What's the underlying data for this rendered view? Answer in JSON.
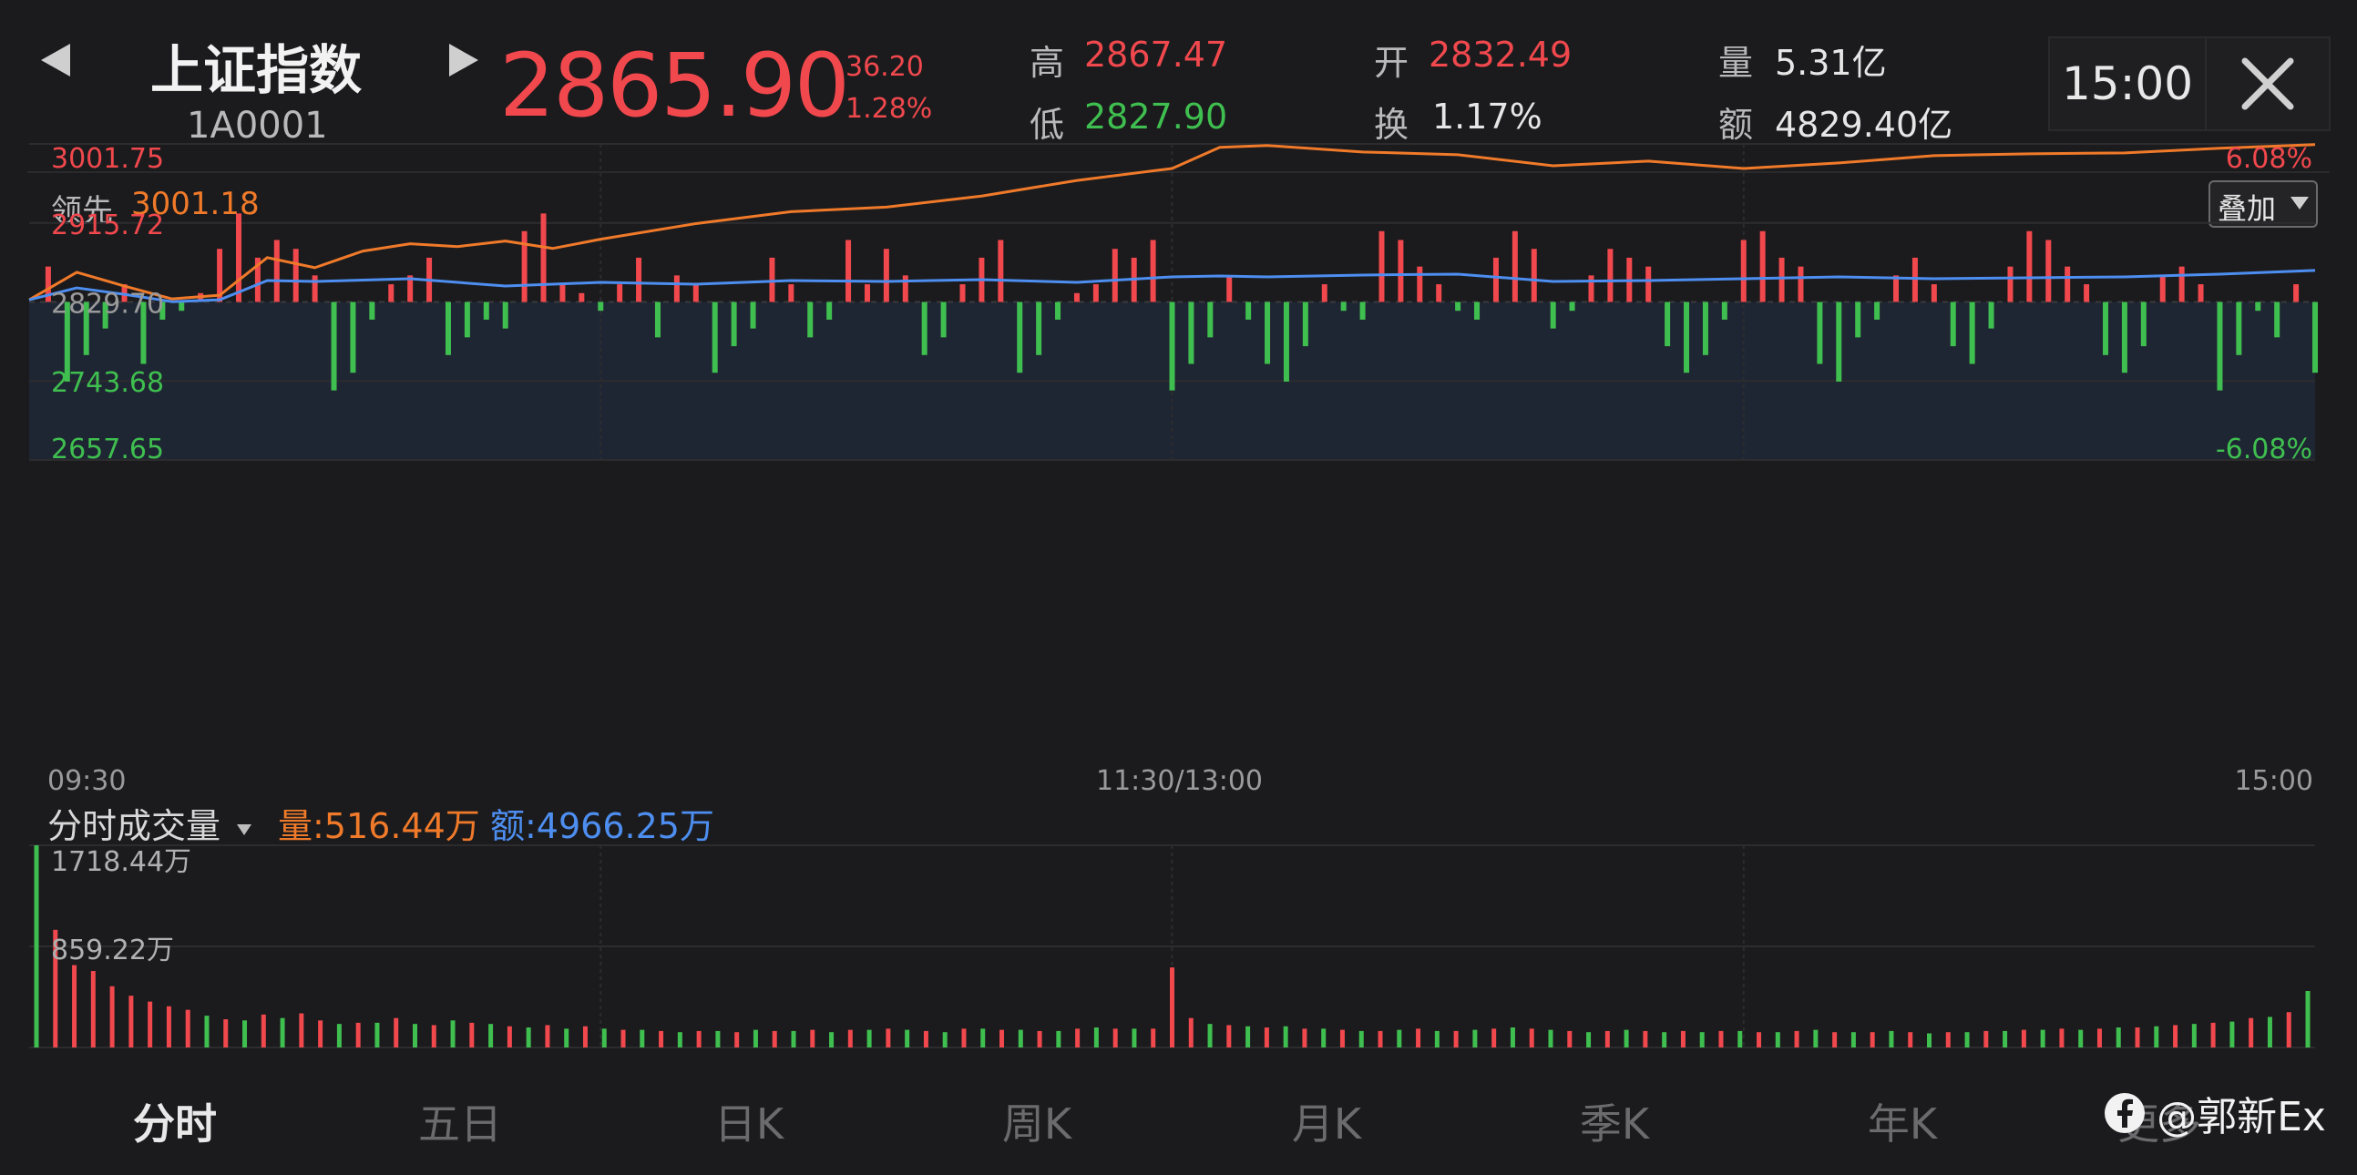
{
  "header": {
    "index_name": "上证指数",
    "index_code": "1A0001",
    "price": "2865.90",
    "change": "36.20",
    "change_pct": "1.28%",
    "high_label": "高",
    "high_value": "2867.47",
    "low_label": "低",
    "low_value": "2827.90",
    "open_label": "开",
    "open_value": "2832.49",
    "turnover_label": "换",
    "turnover_value": "1.17%",
    "volume_label": "量",
    "volume_value": "5.31亿",
    "amount_label": "额",
    "amount_value": "4829.40亿",
    "time": "15:00",
    "close_icon": "close-icon",
    "prev_icon": "triangle-left-icon",
    "next_icon": "triangle-right-icon"
  },
  "price_chart": {
    "leading_label": "领先",
    "leading_value": "3001.18",
    "overlay_label": "叠加",
    "overlay_icon": "caret-down-icon"
  },
  "volume_chart": {
    "title": "分时成交量",
    "title_icon": "caret-down-icon",
    "vol_label": "量:516.44万",
    "amt_label": "额:4966.25万"
  },
  "tabs": [
    "分时",
    "五日",
    "日K",
    "周K",
    "月K",
    "季K",
    "年K",
    "更多"
  ],
  "watermark": "@郭新Ex",
  "colors": {
    "up": "#f0484d",
    "down": "#3fbf4f",
    "leading_line": "#f07a2a",
    "avg_line": "#4d8ef0",
    "background": "#1b1b1d",
    "lower_area": "#1f2633"
  },
  "chart_data": [
    {
      "type": "line",
      "title": "",
      "x_ticks": [
        "09:30",
        "11:30/13:00",
        "15:00"
      ],
      "y_ticks_left": [
        "3001.75",
        "2915.72",
        "2829.70",
        "2743.68",
        "2657.65"
      ],
      "y_ticks_right": [
        "6.08%",
        "-6.08%"
      ],
      "ylim": [
        2657.65,
        3001.75
      ],
      "reference_value": 2829.7,
      "grid": true,
      "series": [
        {
          "name": "领先",
          "color": "#f07a2a",
          "x": [
            0,
            5,
            10,
            15,
            20,
            25,
            30,
            35,
            40,
            45,
            50,
            55,
            60,
            70,
            80,
            90,
            100,
            110,
            120,
            125,
            130,
            140,
            150,
            160,
            170,
            180,
            190,
            200,
            210,
            220,
            230,
            240
          ],
          "values": [
            2832,
            2862,
            2847,
            2833,
            2837,
            2878,
            2867,
            2885,
            2893,
            2890,
            2896,
            2888,
            2898,
            2915,
            2928,
            2933,
            2945,
            2962,
            2975,
            2998,
            3000,
            2993,
            2990,
            2978,
            2983,
            2975,
            2981,
            2989,
            2991,
            2992,
            2997,
            3001
          ]
        },
        {
          "name": "",
          "color": "#4d8ef0",
          "x": [
            0,
            5,
            10,
            15,
            20,
            25,
            30,
            40,
            50,
            60,
            70,
            80,
            90,
            100,
            110,
            120,
            125,
            130,
            140,
            150,
            160,
            170,
            180,
            190,
            200,
            210,
            220,
            230,
            240
          ],
          "values": [
            2832,
            2845,
            2838,
            2830,
            2832,
            2853,
            2852,
            2855,
            2847,
            2851,
            2849,
            2853,
            2852,
            2854,
            2851,
            2857,
            2858,
            2857,
            2859,
            2860,
            2852,
            2853,
            2855,
            2857,
            2855,
            2856,
            2857,
            2860,
            2864
          ]
        }
      ],
      "bars": {
        "x": [
          2,
          4,
          6,
          8,
          10,
          12,
          14,
          16,
          18,
          20,
          22,
          24,
          26,
          28,
          30,
          32,
          34,
          36,
          38,
          40,
          42,
          44,
          46,
          48,
          50,
          52,
          54,
          56,
          58,
          60,
          62,
          64,
          66,
          68,
          70,
          72,
          74,
          76,
          78,
          80,
          82,
          84,
          86,
          88,
          90,
          92,
          94,
          96,
          98,
          100,
          102,
          104,
          106,
          108,
          110,
          112,
          114,
          116,
          118,
          120,
          122,
          124,
          126,
          128,
          130,
          132,
          134,
          136,
          138,
          140,
          142,
          144,
          146,
          148,
          150,
          152,
          154,
          156,
          158,
          160,
          162,
          164,
          166,
          168,
          170,
          172,
          174,
          176,
          178,
          180,
          182,
          184,
          186,
          188,
          190,
          192,
          194,
          196,
          198,
          200,
          202,
          204,
          206,
          208,
          210,
          212,
          214,
          216,
          218,
          220,
          222,
          224,
          226,
          228,
          230,
          232,
          234,
          236,
          238,
          240
        ],
        "values": [
          20,
          -45,
          -30,
          -15,
          10,
          -35,
          -10,
          -5,
          5,
          30,
          50,
          25,
          35,
          30,
          15,
          -50,
          -40,
          -10,
          10,
          15,
          25,
          -30,
          -20,
          -10,
          -15,
          40,
          50,
          10,
          5,
          -5,
          10,
          25,
          -20,
          15,
          10,
          -40,
          -25,
          -15,
          25,
          10,
          -20,
          -10,
          35,
          10,
          30,
          15,
          -30,
          -20,
          10,
          25,
          35,
          -40,
          -30,
          -10,
          5,
          10,
          30,
          25,
          35,
          -50,
          -35,
          -20,
          15,
          -10,
          -35,
          -45,
          -25,
          10,
          -5,
          -10,
          40,
          35,
          20,
          10,
          -5,
          -10,
          25,
          40,
          30,
          -15,
          -5,
          15,
          30,
          25,
          20,
          -25,
          -40,
          -30,
          -10,
          35,
          40,
          25,
          20,
          -35,
          -45,
          -20,
          -10,
          15,
          25,
          10,
          -25,
          -35,
          -15,
          20,
          40,
          35,
          20,
          10,
          -30,
          -40,
          -25,
          15,
          20,
          10,
          -50,
          -30,
          -5,
          -20,
          10,
          -40
        ]
      }
    },
    {
      "type": "bar",
      "title": "分时成交量",
      "y_ticks": [
        "1718.44万",
        "859.22万"
      ],
      "ylim": [
        0,
        1718.44
      ],
      "unit": "万",
      "x": [
        0,
        2,
        4,
        6,
        8,
        10,
        12,
        14,
        16,
        18,
        20,
        22,
        24,
        26,
        28,
        30,
        32,
        34,
        36,
        38,
        40,
        42,
        44,
        46,
        48,
        50,
        52,
        54,
        56,
        58,
        60,
        62,
        64,
        66,
        68,
        70,
        72,
        74,
        76,
        78,
        80,
        82,
        84,
        86,
        88,
        90,
        92,
        94,
        96,
        98,
        100,
        102,
        104,
        106,
        108,
        110,
        112,
        114,
        116,
        118,
        120,
        122,
        124,
        126,
        128,
        130,
        132,
        134,
        136,
        138,
        140,
        142,
        144,
        146,
        148,
        150,
        152,
        154,
        156,
        158,
        160,
        162,
        164,
        166,
        168,
        170,
        172,
        174,
        176,
        178,
        180,
        182,
        184,
        186,
        188,
        190,
        192,
        194,
        196,
        198,
        200,
        202,
        204,
        206,
        208,
        210,
        212,
        214,
        216,
        218,
        220,
        222,
        224,
        226,
        228,
        230,
        232,
        234,
        236,
        238,
        240
      ],
      "values": [
        1718,
        1000,
        700,
        650,
        520,
        440,
        390,
        350,
        320,
        270,
        240,
        230,
        280,
        250,
        290,
        230,
        200,
        210,
        210,
        250,
        200,
        190,
        230,
        210,
        200,
        180,
        170,
        190,
        160,
        180,
        160,
        150,
        150,
        140,
        130,
        140,
        140,
        130,
        150,
        140,
        140,
        150,
        130,
        150,
        150,
        160,
        150,
        140,
        130,
        160,
        160,
        150,
        150,
        140,
        140,
        160,
        170,
        160,
        160,
        160,
        680,
        250,
        200,
        190,
        180,
        170,
        180,
        160,
        160,
        150,
        140,
        140,
        150,
        160,
        140,
        140,
        150,
        160,
        170,
        160,
        150,
        140,
        130,
        140,
        150,
        140,
        130,
        140,
        130,
        140,
        140,
        130,
        130,
        140,
        150,
        130,
        130,
        130,
        140,
        130,
        120,
        130,
        130,
        140,
        140,
        150,
        150,
        160,
        150,
        160,
        170,
        170,
        180,
        190,
        200,
        210,
        220,
        250,
        260,
        300,
        480
      ],
      "colors_up": [
        false,
        true,
        true,
        true,
        true,
        true,
        true,
        true,
        true,
        false,
        true,
        false,
        true,
        false,
        true,
        true,
        false,
        true,
        false,
        true,
        false,
        true,
        false,
        true,
        false,
        true,
        false,
        true,
        false,
        true,
        false,
        true,
        false,
        true,
        false,
        true,
        false,
        true,
        false,
        true,
        false,
        true,
        false,
        true,
        false,
        true,
        false,
        true,
        false,
        true,
        false,
        true,
        false,
        true,
        false,
        true,
        false,
        true,
        false,
        true,
        true,
        true,
        false,
        true,
        false,
        true,
        false,
        true,
        false,
        true,
        false,
        true,
        false,
        true,
        false,
        true,
        false,
        true,
        false,
        true,
        false,
        true,
        false,
        true,
        false,
        true,
        false,
        true,
        false,
        true,
        false,
        true,
        false,
        true,
        false,
        true,
        false,
        true,
        false,
        true,
        false,
        true,
        false,
        true,
        false,
        true,
        false,
        true,
        false,
        true,
        false,
        true,
        false,
        true,
        false,
        true,
        false,
        true,
        false,
        true,
        false
      ]
    }
  ]
}
